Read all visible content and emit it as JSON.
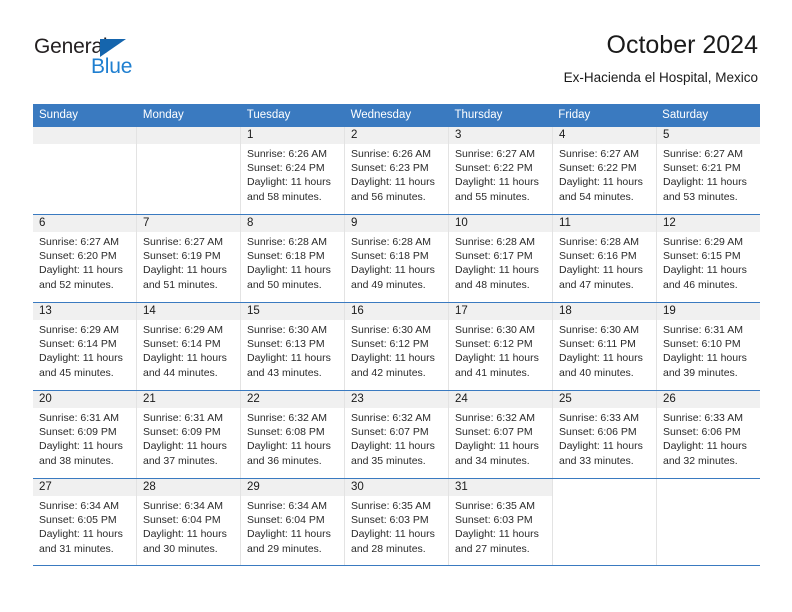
{
  "brand": {
    "name_part1": "General",
    "name_part2": "Blue",
    "triangle_color": "#1565ad",
    "blue_text_color": "#1f7fd0"
  },
  "header": {
    "title": "October 2024",
    "subtitle": "Ex-Hacienda el Hospital, Mexico"
  },
  "theme": {
    "header_band_color": "#3a7ac0",
    "row_divider_color": "#3a7ac0",
    "day_number_band_color": "#f0f0f0",
    "cell_divider_color": "#e3e3e3"
  },
  "weekdays": [
    "Sunday",
    "Monday",
    "Tuesday",
    "Wednesday",
    "Thursday",
    "Friday",
    "Saturday"
  ],
  "weeks": [
    [
      {
        "day": "",
        "empty": true
      },
      {
        "day": "",
        "empty": true
      },
      {
        "day": "1",
        "sunrise": "Sunrise: 6:26 AM",
        "sunset": "Sunset: 6:24 PM",
        "daylight": "Daylight: 11 hours and 58 minutes."
      },
      {
        "day": "2",
        "sunrise": "Sunrise: 6:26 AM",
        "sunset": "Sunset: 6:23 PM",
        "daylight": "Daylight: 11 hours and 56 minutes."
      },
      {
        "day": "3",
        "sunrise": "Sunrise: 6:27 AM",
        "sunset": "Sunset: 6:22 PM",
        "daylight": "Daylight: 11 hours and 55 minutes."
      },
      {
        "day": "4",
        "sunrise": "Sunrise: 6:27 AM",
        "sunset": "Sunset: 6:22 PM",
        "daylight": "Daylight: 11 hours and 54 minutes."
      },
      {
        "day": "5",
        "sunrise": "Sunrise: 6:27 AM",
        "sunset": "Sunset: 6:21 PM",
        "daylight": "Daylight: 11 hours and 53 minutes."
      }
    ],
    [
      {
        "day": "6",
        "sunrise": "Sunrise: 6:27 AM",
        "sunset": "Sunset: 6:20 PM",
        "daylight": "Daylight: 11 hours and 52 minutes."
      },
      {
        "day": "7",
        "sunrise": "Sunrise: 6:27 AM",
        "sunset": "Sunset: 6:19 PM",
        "daylight": "Daylight: 11 hours and 51 minutes."
      },
      {
        "day": "8",
        "sunrise": "Sunrise: 6:28 AM",
        "sunset": "Sunset: 6:18 PM",
        "daylight": "Daylight: 11 hours and 50 minutes."
      },
      {
        "day": "9",
        "sunrise": "Sunrise: 6:28 AM",
        "sunset": "Sunset: 6:18 PM",
        "daylight": "Daylight: 11 hours and 49 minutes."
      },
      {
        "day": "10",
        "sunrise": "Sunrise: 6:28 AM",
        "sunset": "Sunset: 6:17 PM",
        "daylight": "Daylight: 11 hours and 48 minutes."
      },
      {
        "day": "11",
        "sunrise": "Sunrise: 6:28 AM",
        "sunset": "Sunset: 6:16 PM",
        "daylight": "Daylight: 11 hours and 47 minutes."
      },
      {
        "day": "12",
        "sunrise": "Sunrise: 6:29 AM",
        "sunset": "Sunset: 6:15 PM",
        "daylight": "Daylight: 11 hours and 46 minutes."
      }
    ],
    [
      {
        "day": "13",
        "sunrise": "Sunrise: 6:29 AM",
        "sunset": "Sunset: 6:14 PM",
        "daylight": "Daylight: 11 hours and 45 minutes."
      },
      {
        "day": "14",
        "sunrise": "Sunrise: 6:29 AM",
        "sunset": "Sunset: 6:14 PM",
        "daylight": "Daylight: 11 hours and 44 minutes."
      },
      {
        "day": "15",
        "sunrise": "Sunrise: 6:30 AM",
        "sunset": "Sunset: 6:13 PM",
        "daylight": "Daylight: 11 hours and 43 minutes."
      },
      {
        "day": "16",
        "sunrise": "Sunrise: 6:30 AM",
        "sunset": "Sunset: 6:12 PM",
        "daylight": "Daylight: 11 hours and 42 minutes."
      },
      {
        "day": "17",
        "sunrise": "Sunrise: 6:30 AM",
        "sunset": "Sunset: 6:12 PM",
        "daylight": "Daylight: 11 hours and 41 minutes."
      },
      {
        "day": "18",
        "sunrise": "Sunrise: 6:30 AM",
        "sunset": "Sunset: 6:11 PM",
        "daylight": "Daylight: 11 hours and 40 minutes."
      },
      {
        "day": "19",
        "sunrise": "Sunrise: 6:31 AM",
        "sunset": "Sunset: 6:10 PM",
        "daylight": "Daylight: 11 hours and 39 minutes."
      }
    ],
    [
      {
        "day": "20",
        "sunrise": "Sunrise: 6:31 AM",
        "sunset": "Sunset: 6:09 PM",
        "daylight": "Daylight: 11 hours and 38 minutes."
      },
      {
        "day": "21",
        "sunrise": "Sunrise: 6:31 AM",
        "sunset": "Sunset: 6:09 PM",
        "daylight": "Daylight: 11 hours and 37 minutes."
      },
      {
        "day": "22",
        "sunrise": "Sunrise: 6:32 AM",
        "sunset": "Sunset: 6:08 PM",
        "daylight": "Daylight: 11 hours and 36 minutes."
      },
      {
        "day": "23",
        "sunrise": "Sunrise: 6:32 AM",
        "sunset": "Sunset: 6:07 PM",
        "daylight": "Daylight: 11 hours and 35 minutes."
      },
      {
        "day": "24",
        "sunrise": "Sunrise: 6:32 AM",
        "sunset": "Sunset: 6:07 PM",
        "daylight": "Daylight: 11 hours and 34 minutes."
      },
      {
        "day": "25",
        "sunrise": "Sunrise: 6:33 AM",
        "sunset": "Sunset: 6:06 PM",
        "daylight": "Daylight: 11 hours and 33 minutes."
      },
      {
        "day": "26",
        "sunrise": "Sunrise: 6:33 AM",
        "sunset": "Sunset: 6:06 PM",
        "daylight": "Daylight: 11 hours and 32 minutes."
      }
    ],
    [
      {
        "day": "27",
        "sunrise": "Sunrise: 6:34 AM",
        "sunset": "Sunset: 6:05 PM",
        "daylight": "Daylight: 11 hours and 31 minutes."
      },
      {
        "day": "28",
        "sunrise": "Sunrise: 6:34 AM",
        "sunset": "Sunset: 6:04 PM",
        "daylight": "Daylight: 11 hours and 30 minutes."
      },
      {
        "day": "29",
        "sunrise": "Sunrise: 6:34 AM",
        "sunset": "Sunset: 6:04 PM",
        "daylight": "Daylight: 11 hours and 29 minutes."
      },
      {
        "day": "30",
        "sunrise": "Sunrise: 6:35 AM",
        "sunset": "Sunset: 6:03 PM",
        "daylight": "Daylight: 11 hours and 28 minutes."
      },
      {
        "day": "31",
        "sunrise": "Sunrise: 6:35 AM",
        "sunset": "Sunset: 6:03 PM",
        "daylight": "Daylight: 11 hours and 27 minutes."
      },
      {
        "day": "",
        "blank": true
      },
      {
        "day": "",
        "blank": true
      }
    ]
  ]
}
